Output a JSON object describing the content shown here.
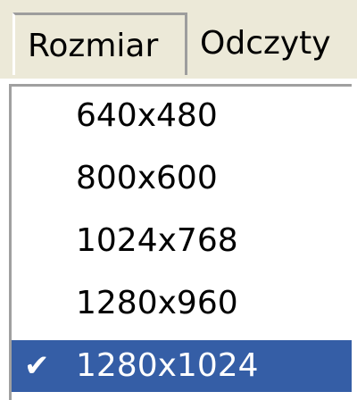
{
  "menubar": {
    "items": [
      {
        "label": "Rozmiar"
      },
      {
        "label": "Odczyty"
      }
    ]
  },
  "dropdown": {
    "items": [
      {
        "label": "640x480",
        "checked": false
      },
      {
        "label": "800x600",
        "checked": false
      },
      {
        "label": "1024x768",
        "checked": false
      },
      {
        "label": "1280x960",
        "checked": false
      },
      {
        "label": "1280x1024",
        "checked": true
      }
    ],
    "check_glyph": "✔"
  },
  "colors": {
    "menubar_bg": "#ece9d8",
    "selection_bg": "#355ea6",
    "selection_text": "#ffffff"
  }
}
